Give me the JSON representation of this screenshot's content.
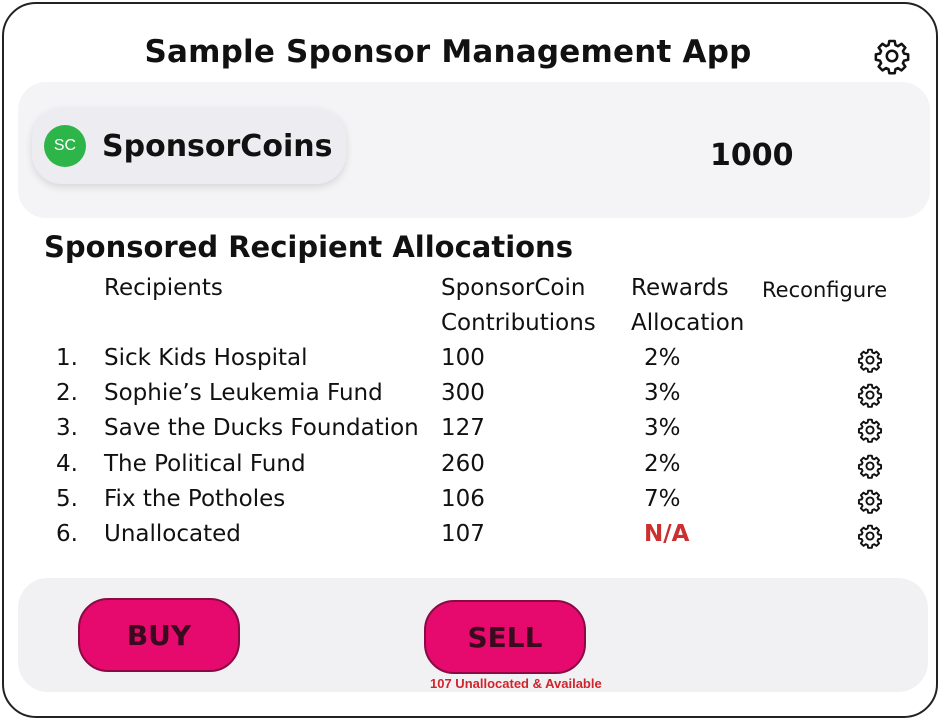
{
  "header": {
    "title": "Sample Sponsor Management App",
    "settings_icon": "gear-icon"
  },
  "coin": {
    "logo_text": "SC",
    "logo_color": "#2eb54a",
    "name": "SponsorCoins",
    "balance": "1000"
  },
  "allocations": {
    "title": "Sponsored Recipient Allocations",
    "columns": {
      "recipients": "Recipients",
      "contributions_line1": "SponsorCoin",
      "contributions_line2": "Contributions",
      "rewards_line1": "Rewards",
      "rewards_line2": "Allocation",
      "reconfigure": "Reconfigure"
    },
    "rows": [
      {
        "num": "1.",
        "name": "Sick Kids Hospital",
        "contribution": "100",
        "reward": "2%",
        "icon": "gear-icon"
      },
      {
        "num": "2.",
        "name": "Sophie’s Leukemia Fund",
        "contribution": "300",
        "reward": "3%",
        "icon": "gear-icon"
      },
      {
        "num": "3.",
        "name": "Save the Ducks Foundation",
        "contribution": "127",
        "reward": "3%",
        "icon": "gear-icon"
      },
      {
        "num": "4.",
        "name": "The Political Fund",
        "contribution": "260",
        "reward": "2%",
        "icon": "gear-icon"
      },
      {
        "num": "5.",
        "name": "Fix the Potholes",
        "contribution": "106",
        "reward": "7%",
        "icon": "gear-icon"
      },
      {
        "num": "6.",
        "name": "Unallocated",
        "contribution": "107",
        "reward": "N/A",
        "icon": "gear-icon"
      }
    ]
  },
  "actions": {
    "buy_label": "BUY",
    "sell_label": "SELL",
    "available_note": "107 Unallocated & Available",
    "button_color": "#e6096e",
    "note_color": "#d0242c"
  }
}
